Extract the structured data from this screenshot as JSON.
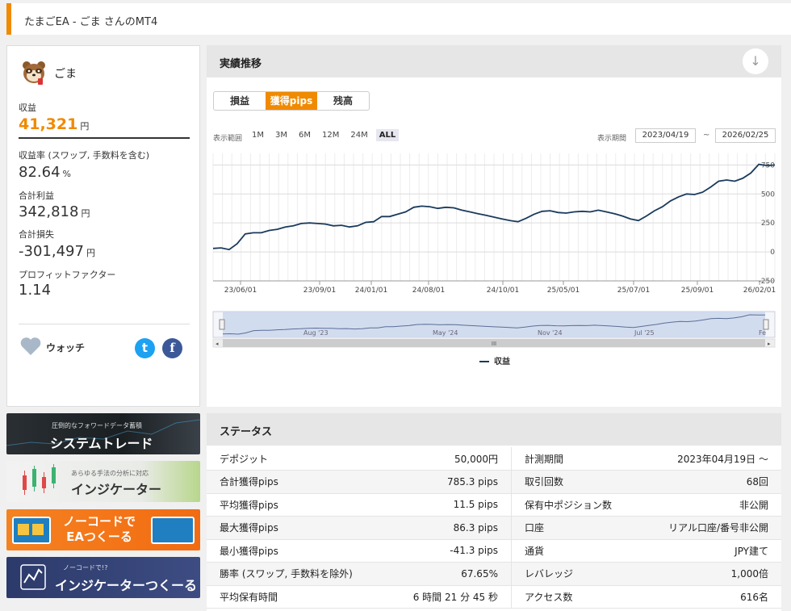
{
  "header": {
    "title": "たまごEA - ごま さんのMT4"
  },
  "profile": {
    "username": "ごま",
    "avatar_icon": "tanuki-avatar",
    "profit_label": "収益",
    "profit_value": "41,321",
    "profit_unit": "円",
    "rate_label": "収益率 (スワップ, 手数料を含む)",
    "rate_value": "82.64",
    "rate_unit": "%",
    "gross_profit_label": "合計利益",
    "gross_profit_value": "342,818",
    "gross_profit_unit": "円",
    "gross_loss_label": "合計損失",
    "gross_loss_value": "-301,497",
    "gross_loss_unit": "円",
    "pf_label": "プロフィットファクター",
    "pf_value": "1.14",
    "watch_label": "ウォッチ",
    "twitter_icon": "t",
    "facebook_icon": "f"
  },
  "banners": [
    {
      "sub": "圧倒的なフォワードデータ蓄積",
      "main": "システムトレード"
    },
    {
      "sub": "あらゆる手法の分析に対応",
      "main": "インジケーター"
    },
    {
      "main1": "ノーコードで",
      "main2": "EAつくーる"
    },
    {
      "sub": "ノーコードで!?",
      "main": "インジケーターつくーる"
    }
  ],
  "perf": {
    "title": "実績推移",
    "download_icon": "↓",
    "tabs": [
      "損益",
      "獲得pips",
      "残高"
    ],
    "active_tab": 1,
    "range_label": "表示範囲",
    "ranges": [
      "1M",
      "3M",
      "6M",
      "12M",
      "24M",
      "ALL"
    ],
    "active_range": 5,
    "period_label": "表示期間",
    "date_from": "2023/04/19",
    "date_tilde": "~",
    "date_to": "2026/02/25",
    "navigator_labels": [
      "Aug '23",
      "May '24",
      "Nov '24",
      "Jul '25",
      "Fe"
    ],
    "scroll_mid": "III"
  },
  "chart_data": {
    "type": "line",
    "x_ticks": [
      "23/06/01",
      "23/09/01",
      "24/01/01",
      "24/08/01",
      "24/10/01",
      "25/05/01",
      "25/07/01",
      "25/09/01",
      "26/02/01"
    ],
    "y_ticks": [
      750,
      500,
      250,
      0,
      -250
    ],
    "ylim": [
      -250,
      850
    ],
    "series": [
      {
        "name": "収益",
        "color": "#1a3a5c",
        "values": [
          30,
          35,
          20,
          70,
          155,
          165,
          165,
          185,
          195,
          215,
          225,
          245,
          250,
          245,
          240,
          225,
          230,
          215,
          225,
          255,
          260,
          305,
          305,
          325,
          345,
          385,
          395,
          390,
          375,
          385,
          380,
          360,
          345,
          330,
          315,
          300,
          285,
          270,
          260,
          290,
          325,
          350,
          355,
          340,
          335,
          345,
          350,
          345,
          360,
          345,
          330,
          310,
          285,
          270,
          310,
          355,
          390,
          440,
          475,
          500,
          495,
          515,
          560,
          610,
          620,
          610,
          635,
          680,
          755,
          745,
          750
        ]
      }
    ],
    "legend": "bottom-center"
  },
  "status": {
    "title": "ステータス",
    "rows": [
      [
        "デポジット",
        "50,000円",
        "計測期間",
        "2023年04月19日 ～"
      ],
      [
        "合計獲得pips",
        "785.3 pips",
        "取引回数",
        "68回"
      ],
      [
        "平均獲得pips",
        "11.5 pips",
        "保有中ポジション数",
        "非公開"
      ],
      [
        "最大獲得pips",
        "86.3 pips",
        "口座",
        "リアル口座/番号非公開"
      ],
      [
        "最小獲得pips",
        "-41.3 pips",
        "通貨",
        "JPY建て"
      ],
      [
        "勝率 (スワップ, 手数料を除外)",
        "67.65%",
        "レバレッジ",
        "1,000倍"
      ],
      [
        "平均保有時間",
        "6 時間 21 分 45 秒",
        "アクセス数",
        "616名"
      ]
    ]
  }
}
